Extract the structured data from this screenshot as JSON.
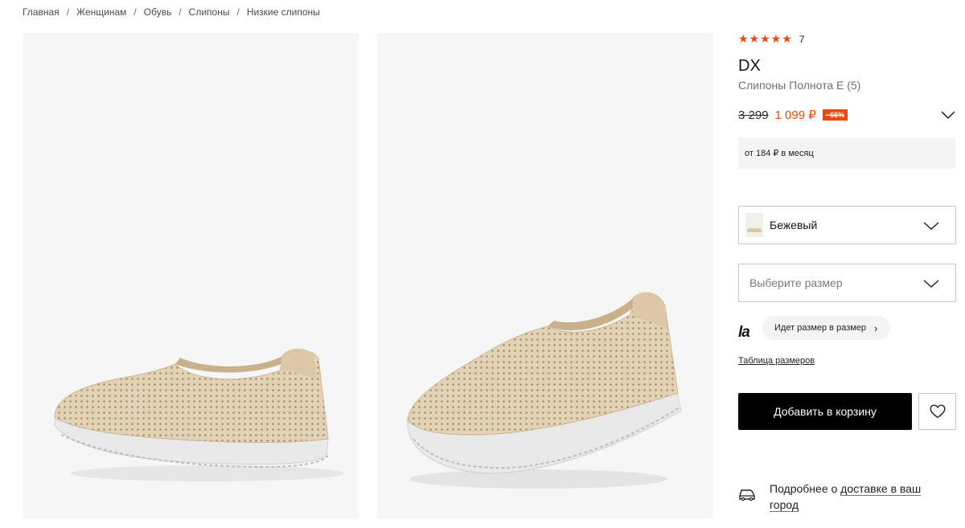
{
  "breadcrumb": {
    "items": [
      "Главная",
      "Женщинам",
      "Обувь",
      "Слипоны",
      "Низкие слипоны"
    ],
    "separator": "/"
  },
  "product": {
    "rating_stars": "★★★★★",
    "rating_count": "7",
    "brand": "DX",
    "name": "Слипоны Полнота E (5)",
    "old_price": "3 299",
    "new_price": "1 099 ₽",
    "discount": "−66%",
    "installment": "от 184 ₽ в месяц"
  },
  "color_select": {
    "value": "Бежевый"
  },
  "size_select": {
    "placeholder": "Выберите размер"
  },
  "fit": {
    "logo": "la",
    "label": "Идет размер в размер",
    "arrow": "›"
  },
  "size_table_link": "Таблица размеров",
  "add_to_cart": "Добавить в корзину",
  "delivery": {
    "prefix": "Подробнее о ",
    "link": "доставке в ваш город"
  },
  "colors": {
    "accent": "#f1470d",
    "button_bg": "#000000",
    "gallery_bg": "#f6f6f6",
    "shoe_upper": "#e3d2b6",
    "shoe_sole": "#e8e8e8"
  },
  "icons": [
    "star-icon",
    "chevron-down-icon",
    "heart-icon",
    "truck-icon",
    "chevron-right-icon"
  ]
}
